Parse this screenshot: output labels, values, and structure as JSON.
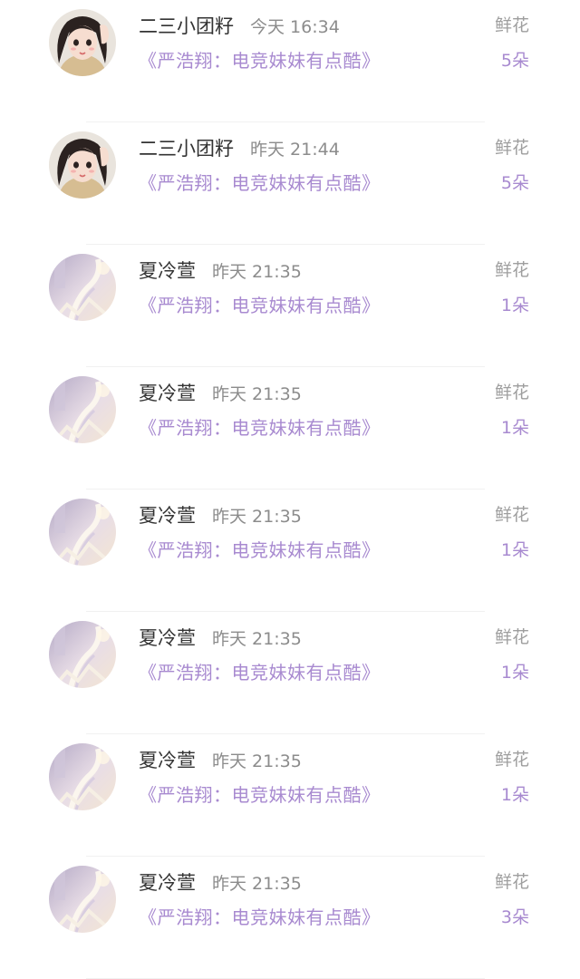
{
  "gifts": [
    {
      "user": "二三小团籽",
      "time": "今天 16:34",
      "book": "《严浩翔：电竞妹妹有点酷》",
      "gift": "鲜花",
      "count": "5朵",
      "avatar": "girl-avatar"
    },
    {
      "user": "二三小团籽",
      "time": "昨天 21:44",
      "book": "《严浩翔：电竞妹妹有点酷》",
      "gift": "鲜花",
      "count": "5朵",
      "avatar": "girl-avatar"
    },
    {
      "user": "夏冷萱",
      "time": "昨天 21:35",
      "book": "《严浩翔：电竞妹妹有点酷》",
      "gift": "鲜花",
      "count": "1朵",
      "avatar": "staircase-avatar"
    },
    {
      "user": "夏冷萱",
      "time": "昨天 21:35",
      "book": "《严浩翔：电竞妹妹有点酷》",
      "gift": "鲜花",
      "count": "1朵",
      "avatar": "staircase-avatar"
    },
    {
      "user": "夏冷萱",
      "time": "昨天 21:35",
      "book": "《严浩翔：电竞妹妹有点酷》",
      "gift": "鲜花",
      "count": "1朵",
      "avatar": "staircase-avatar"
    },
    {
      "user": "夏冷萱",
      "time": "昨天 21:35",
      "book": "《严浩翔：电竞妹妹有点酷》",
      "gift": "鲜花",
      "count": "1朵",
      "avatar": "staircase-avatar"
    },
    {
      "user": "夏冷萱",
      "time": "昨天 21:35",
      "book": "《严浩翔：电竞妹妹有点酷》",
      "gift": "鲜花",
      "count": "1朵",
      "avatar": "staircase-avatar"
    },
    {
      "user": "夏冷萱",
      "time": "昨天 21:35",
      "book": "《严浩翔：电竞妹妹有点酷》",
      "gift": "鲜花",
      "count": "3朵",
      "avatar": "staircase-avatar"
    }
  ],
  "colors": {
    "accent": "#a88ad0",
    "name": "#333333",
    "muted": "#8c8c8c"
  }
}
